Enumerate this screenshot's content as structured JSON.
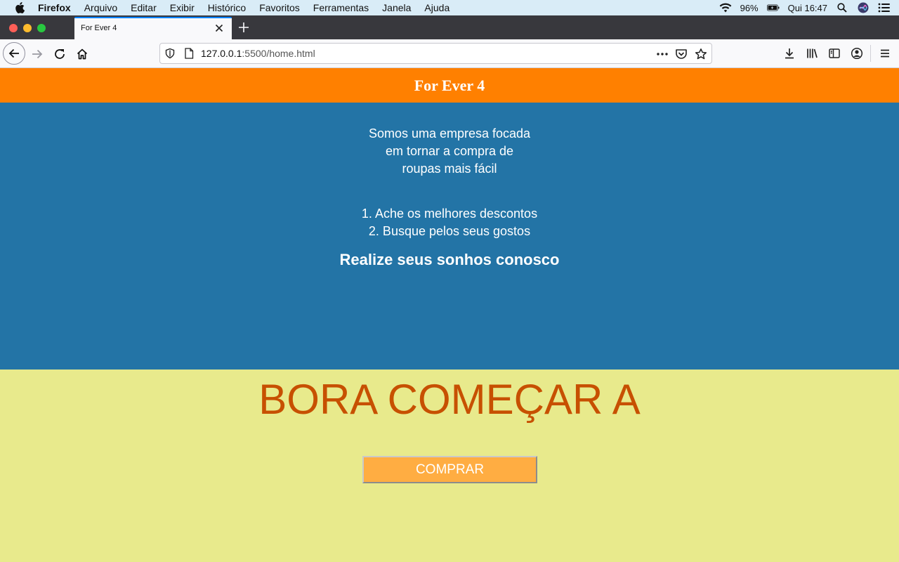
{
  "os_menubar": {
    "app_name": "Firefox",
    "menus": [
      "Arquivo",
      "Editar",
      "Exibir",
      "Histórico",
      "Favoritos",
      "Ferramentas",
      "Janela",
      "Ajuda"
    ],
    "battery": "96%",
    "clock": "Qui 16:47"
  },
  "browser": {
    "tab_title": "For Ever 4",
    "url_host": "127.0.0.1",
    "url_path": ":5500/home.html"
  },
  "page": {
    "header_title": "For Ever 4",
    "intro_lines": [
      "Somos uma empresa focada",
      "em tornar a compra de",
      "roupas mais fácil"
    ],
    "list_items": [
      "1. Ache os melhores descontos",
      "2. Busque pelos seus gostos"
    ],
    "slogan": "Realize seus sonhos conosco",
    "cta_heading": "BORA COMEÇAR A",
    "cta_button": "COMPRAR"
  },
  "colors": {
    "header_bg": "#ff8000",
    "hero_bg": "#2374a6",
    "cta_bg": "#e8ea8c",
    "cta_heading": "#c75000",
    "button_bg": "#ffad42"
  }
}
